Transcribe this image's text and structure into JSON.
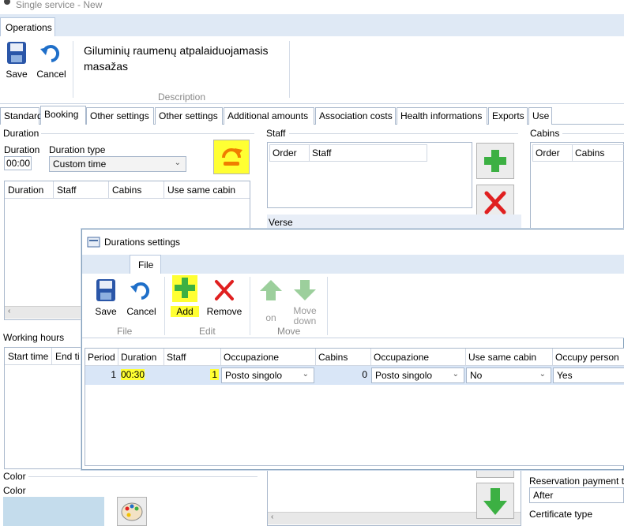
{
  "window": {
    "title": "Single service - New"
  },
  "ribbon": {
    "tab": "Operations",
    "save_label": "Save",
    "cancel_label": "Cancel",
    "description_text_line1": "Giluminių raumenų atpalaiduojamasis",
    "description_text_line2": "masažas",
    "description_group": "Description"
  },
  "tabs": [
    "Standard",
    "Booking",
    "Other settings",
    "Other settings",
    "Additional amounts",
    "Association costs",
    "Health informations",
    "Exports",
    "Use"
  ],
  "duration_section": {
    "title": "Duration",
    "duration_label": "Duration",
    "duration_value": "00:00",
    "type_label": "Duration type",
    "type_value": "Custom time",
    "grid_columns": [
      "Duration",
      "Staff",
      "Cabins",
      "Use same cabin"
    ]
  },
  "staff_section": {
    "title": "Staff",
    "grid_columns": [
      "Order",
      "Staff"
    ],
    "verse_label": "Verse"
  },
  "cabins_section": {
    "title": "Cabins",
    "grid_columns": [
      "Order",
      "Cabins"
    ]
  },
  "working_hours": {
    "title": "Working hours",
    "grid_columns": [
      "Start time",
      "End ti"
    ]
  },
  "color_section": {
    "title": "Color",
    "label": "Color"
  },
  "right_panel": {
    "reservation_payment_label": "Reservation payment ty",
    "reservation_payment_value": "After",
    "certificate_type_label": "Certificate type"
  },
  "dialog": {
    "title": "Durations settings",
    "ribbon_tab": "File",
    "file_group": {
      "label": "File",
      "save": "Save",
      "cancel": "Cancel"
    },
    "edit_group": {
      "label": "Edit",
      "add": "Add",
      "remove": "Remove"
    },
    "move_group": {
      "label": "Move",
      "on": "on",
      "move_down_1": "Move",
      "move_down_2": "down"
    },
    "columns": [
      "Period",
      "Duration",
      "Staff",
      "Occupazione",
      "Cabins",
      "Occupazione",
      "Use same cabin",
      "Occupy person"
    ],
    "rows": [
      {
        "period": "1",
        "duration": "00:30",
        "staff": "1",
        "occupazione": "Posto singolo",
        "cabins": "0",
        "occupazione2": "Posto singolo",
        "use_same_cabin": "No",
        "occupy_person": "Yes"
      }
    ]
  },
  "colors": {
    "highlight": "#ffff33",
    "accent_green": "#3cb043",
    "accent_red": "#e02020",
    "accent_blue": "#1f6fc9",
    "ribbon_bg": "#dfe9f5"
  }
}
